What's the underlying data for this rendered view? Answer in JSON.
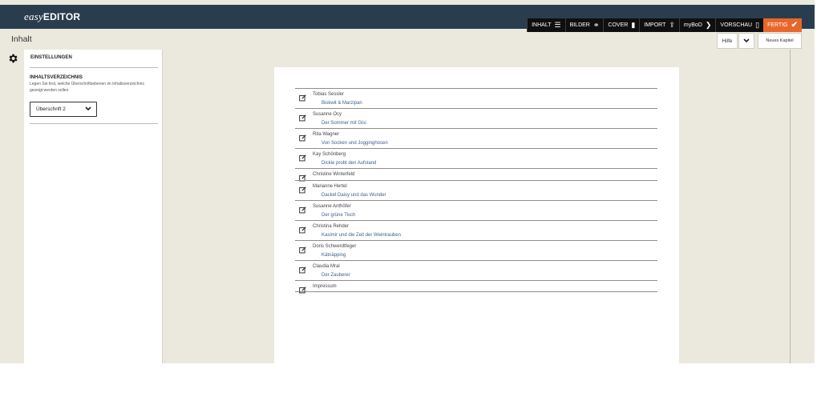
{
  "app": {
    "logo_easy": "easy",
    "logo_editor": "EDITOR"
  },
  "nav": {
    "items": [
      {
        "label": "INHALT",
        "icon": "list-icon",
        "glyph": "☰"
      },
      {
        "label": "BILDER",
        "icon": "paperclip-icon",
        "glyph": "⚭"
      },
      {
        "label": "COVER",
        "icon": "book-icon",
        "glyph": "▮"
      },
      {
        "label": "IMPORT",
        "icon": "upload-icon",
        "glyph": "⇪"
      },
      {
        "label": "myBoD",
        "icon": "chevron-right-icon",
        "glyph": "❯"
      },
      {
        "label": "VORSCHAU",
        "icon": "phone-icon",
        "glyph": "▯"
      }
    ],
    "done": {
      "label": "FERTIG",
      "icon": "checkmark-icon",
      "glyph": "✔"
    }
  },
  "title_bar": {
    "title": "Inhalt",
    "help_label": "Hilfe",
    "new_chapter_label": "Neues Kapitel"
  },
  "settings": {
    "heading": "EINSTELLUNGEN",
    "toc_title": "INHALTSVERZEICHNIS",
    "toc_description": "Legen Sie fest, welche Überschriftsebenen im Inhaltsverzeichnis gezeigt werden sollen",
    "heading_level_selected": "Überschrift 2"
  },
  "toc": [
    {
      "author": "Tobias Sessler",
      "work": "Biskwit & Marzipan"
    },
    {
      "author": "Susanne Ocy",
      "work": "Der Sommer mit Gisi"
    },
    {
      "author": "Rita Wagner",
      "work": "Von Socken und Jogginghosen"
    },
    {
      "author": "Kay Schönberg",
      "work": "Dickie probt den Aufstand"
    },
    {
      "author": "Christine Winterfeld",
      "work": ""
    },
    {
      "author": "Marianne Hertel",
      "work": "Dackel Daisy und das Wunder"
    },
    {
      "author": "Susanne Anthöfer",
      "work": "Der grüne Tisch"
    },
    {
      "author": "Christina Rehder",
      "work": "Kasimir und die Zeit der Weintrauben"
    },
    {
      "author": "Doris Schwerdtfeger",
      "work": "Kätnäpping"
    },
    {
      "author": "Claudia Mral",
      "work": "Der Zauberer"
    },
    {
      "author": "Impressum",
      "work": ""
    }
  ],
  "colors": {
    "topbar": "#2a3d4f",
    "accent": "#e8672a",
    "background": "#ebe9de",
    "link": "#3f5f8a"
  }
}
